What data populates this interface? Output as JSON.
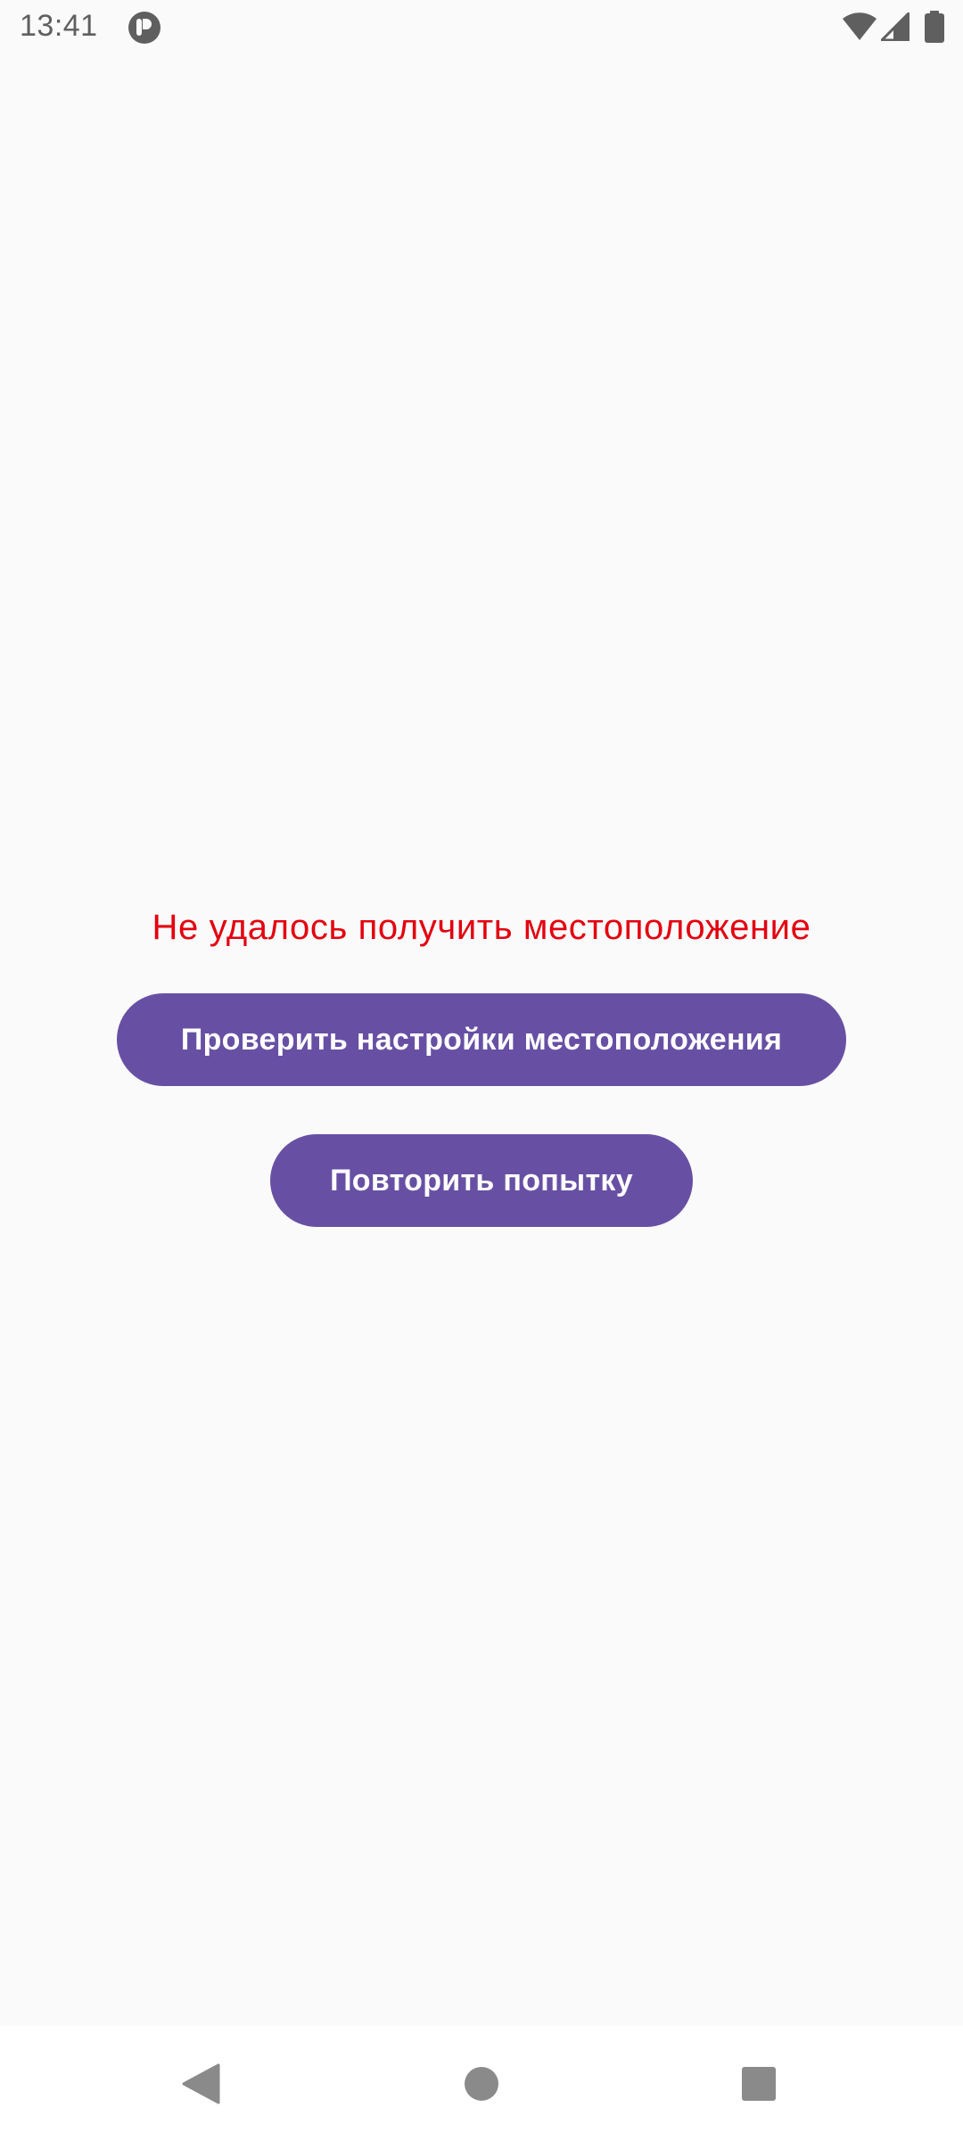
{
  "status_bar": {
    "time": "13:41",
    "icons": [
      "app-notification-icon",
      "wifi-icon",
      "signal-icon",
      "battery-icon"
    ]
  },
  "main": {
    "error_message": "Не удалось получить местоположение",
    "check_settings_label": "Проверить настройки местоположения",
    "retry_label": "Повторить попытку"
  },
  "nav_bar": {
    "icons": [
      "back-icon",
      "home-icon",
      "recents-icon"
    ]
  },
  "colors": {
    "background": "#fafafa",
    "error_text": "#e3000f",
    "button_bg": "#6750a4",
    "button_text": "#ffffff",
    "status_text": "#5f5f5f",
    "nav_icon": "#8a8a8a"
  }
}
